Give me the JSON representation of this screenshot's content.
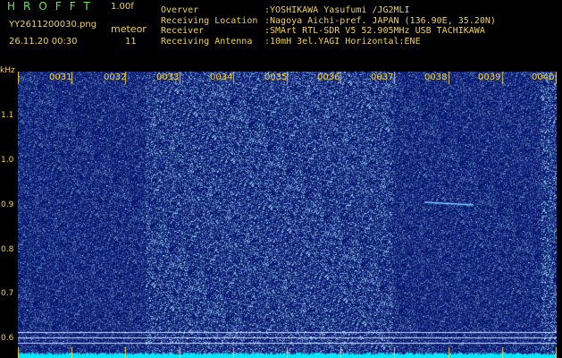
{
  "header": {
    "brand": "HROFFT",
    "version": "1.00f",
    "filename": "YY2611200030.png",
    "meteor_label": "meteor",
    "datetime": "26.11.20 00:30",
    "meteor_count": "11"
  },
  "info": [
    {
      "key": "Overver",
      "value": ":YOSHIKAWA Yasufumi /JG2MLI"
    },
    {
      "key": "Receiving Location",
      "value": ":Nagoya Aichi-pref. JAPAN (136.90E, 35.20N)"
    },
    {
      "key": "Receiver",
      "value": ":SMArt RTL-SDR V5 52.905MHz USB TACHIKAWA"
    },
    {
      "key": "Receiving Antenna",
      "value": ":10mH 3el.YAGI Horizontal:ENE"
    }
  ],
  "axis": {
    "y_unit": "kHz",
    "y_ticks": [
      "1.1",
      "1.0",
      "0.9",
      "0.8",
      "0.7",
      "0.6"
    ],
    "x_ticks": [
      "0031",
      "0032",
      "0033",
      "0034",
      "0035",
      "0036",
      "0037",
      "0038",
      "0039",
      "0040"
    ]
  },
  "colors": {
    "background": "#000000",
    "label_yellow": "#f2d24a",
    "brand_green": "#6ee05a",
    "noise_base": "#05157a",
    "noise_bright": "#9fd8ff",
    "baseline_cyan": "#00ffff"
  }
}
